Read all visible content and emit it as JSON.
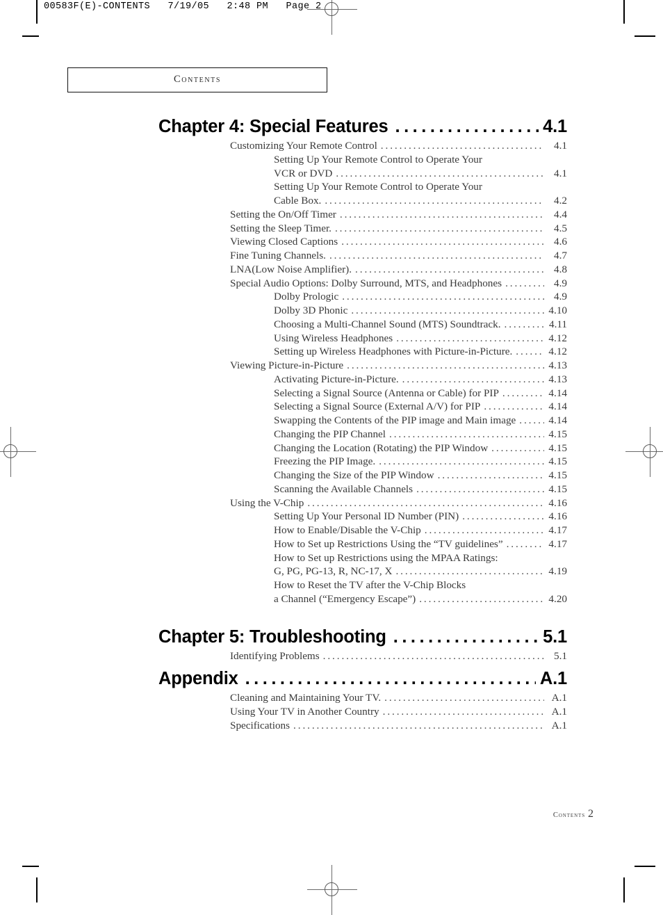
{
  "prepress": {
    "header_strip": "00583F(E)-CONTENTS   7/19/05   2:48 PM   Page 2"
  },
  "contents_box": {
    "label": "Contents"
  },
  "footer": {
    "label": "Contents",
    "page_number": "2"
  },
  "toc": {
    "chapters": [
      {
        "title": "Chapter 4: Special Features",
        "page": "4.1",
        "entries": [
          {
            "level": 1,
            "text": "Customizing Your Remote Control",
            "page": "4.1"
          },
          {
            "level": 2,
            "text": "Setting Up Your Remote Control to Operate Your",
            "page": ""
          },
          {
            "level": 2,
            "text": "VCR or DVD",
            "page": "4.1"
          },
          {
            "level": 2,
            "text": "Setting Up Your Remote Control to Operate Your",
            "page": ""
          },
          {
            "level": 2,
            "text": "Cable Box.",
            "page": "4.2"
          },
          {
            "level": 1,
            "text": "Setting the On/Off Timer",
            "page": "4.4"
          },
          {
            "level": 1,
            "text": "Setting the Sleep Timer.",
            "page": "4.5"
          },
          {
            "level": 1,
            "text": "Viewing Closed Captions",
            "page": "4.6"
          },
          {
            "level": 1,
            "text": "Fine Tuning Channels.",
            "page": "4.7"
          },
          {
            "level": 1,
            "text": "LNA(Low Noise Amplifier).",
            "page": "4.8"
          },
          {
            "level": 1,
            "text": "Special Audio Options: Dolby Surround, MTS, and Headphones",
            "page": "4.9"
          },
          {
            "level": 2,
            "text": "Dolby Prologic",
            "page": "4.9"
          },
          {
            "level": 2,
            "text": "Dolby 3D Phonic",
            "page": "4.10"
          },
          {
            "level": 2,
            "text": "Choosing a Multi-Channel Sound (MTS) Soundtrack.",
            "page": "4.11"
          },
          {
            "level": 2,
            "text": "Using Wireless Headphones",
            "page": "4.12"
          },
          {
            "level": 2,
            "text": "Setting up Wireless Headphones with Picture-in-Picture.",
            "page": "4.12"
          },
          {
            "level": 1,
            "text": "Viewing Picture-in-Picture",
            "page": "4.13"
          },
          {
            "level": 2,
            "text": "Activating Picture-in-Picture.",
            "page": "4.13"
          },
          {
            "level": 2,
            "text": "Selecting a Signal Source (Antenna or Cable) for PIP",
            "page": "4.14"
          },
          {
            "level": 2,
            "text": "Selecting a Signal Source (External A/V) for PIP",
            "page": "4.14"
          },
          {
            "level": 2,
            "text": "Swapping the Contents of the PIP image and Main image",
            "page": "4.14"
          },
          {
            "level": 2,
            "text": "Changing the PIP Channel",
            "page": "4.15"
          },
          {
            "level": 2,
            "text": "Changing the Location (Rotating) the PIP Window",
            "page": "4.15"
          },
          {
            "level": 2,
            "text": "Freezing the PIP Image.",
            "page": "4.15"
          },
          {
            "level": 2,
            "text": "Changing the Size of the PIP Window",
            "page": "4.15"
          },
          {
            "level": 2,
            "text": "Scanning the Available Channels",
            "page": "4.15"
          },
          {
            "level": 1,
            "text": "Using the V-Chip",
            "page": "4.16"
          },
          {
            "level": 2,
            "text": "Setting Up Your Personal ID Number (PIN)",
            "page": "4.16"
          },
          {
            "level": 2,
            "text": "How to Enable/Disable the V-Chip",
            "page": "4.17"
          },
          {
            "level": 2,
            "text": "How to Set up Restrictions Using the “TV guidelines”",
            "page": "4.17"
          },
          {
            "level": 2,
            "text": "How to Set up Restrictions using the MPAA Ratings:",
            "page": ""
          },
          {
            "level": 2,
            "text": "G, PG, PG-13, R, NC-17, X",
            "page": "4.19"
          },
          {
            "level": 2,
            "text": "How to Reset the TV after the V-Chip Blocks",
            "page": ""
          },
          {
            "level": 2,
            "text": "a Channel (“Emergency Escape”)",
            "page": "4.20"
          }
        ]
      },
      {
        "title": "Chapter 5: Troubleshooting",
        "page": "5.1",
        "entries": [
          {
            "level": 1,
            "text": "Identifying Problems",
            "page": "5.1"
          }
        ]
      },
      {
        "title": "Appendix",
        "page": "A.1",
        "entries": [
          {
            "level": 1,
            "text": "Cleaning and Maintaining Your TV.",
            "page": "A.1"
          },
          {
            "level": 1,
            "text": "Using Your TV in Another Country",
            "page": "A.1"
          },
          {
            "level": 1,
            "text": "Specifications",
            "page": "A.1"
          }
        ]
      }
    ]
  }
}
